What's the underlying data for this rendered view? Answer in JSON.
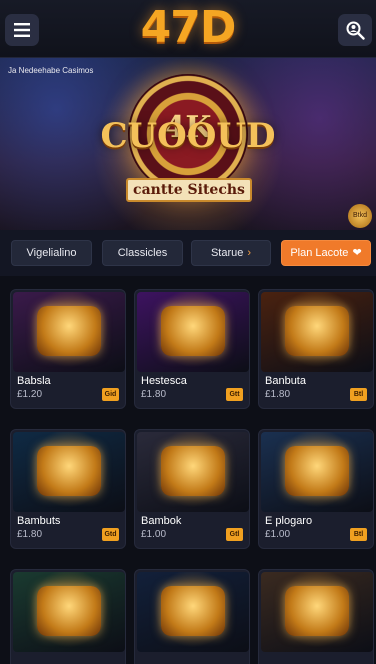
{
  "header": {
    "logo": "47D",
    "menu_icon": "hamburger-menu-icon",
    "search_icon": "search-user-icon"
  },
  "hero": {
    "caption": "Ja Nedeehabe Casimos",
    "big_number": "4K",
    "title": "CUOOUD",
    "subtitle": "cantte Sitechs",
    "coin_label": "Btkd"
  },
  "filters": [
    {
      "label": "Vigelialino",
      "arrow": ""
    },
    {
      "label": "Classicles",
      "arrow": ""
    },
    {
      "label": "Starue",
      "arrow": "›"
    },
    {
      "label": "Plan Lacote",
      "arrow": "❤"
    }
  ],
  "games": [
    {
      "name": "Babsla",
      "price": "£1.20",
      "badge": "Gid",
      "theme": "#3a1a4a"
    },
    {
      "name": "Hestesca",
      "price": "£1.80",
      "badge": "Gtt",
      "theme": "#3d1360"
    },
    {
      "name": "Banbuta",
      "price": "£1.80",
      "badge": "Btl",
      "theme": "#4a2210"
    },
    {
      "name": "Bambuts",
      "price": "£1.80",
      "badge": "Gtd",
      "theme": "#0f2a44"
    },
    {
      "name": "Bambok",
      "price": "£1.00",
      "badge": "Gtl",
      "theme": "#2a2a3a"
    },
    {
      "name": "E plogaro",
      "price": "£1.00",
      "badge": "Btl",
      "theme": "#1a3050"
    },
    {
      "name": "",
      "price": "",
      "badge": "",
      "theme": "#1a3a30"
    },
    {
      "name": "",
      "price": "",
      "badge": "",
      "theme": "#12203a"
    },
    {
      "name": "",
      "price": "",
      "badge": "",
      "theme": "#3a2a20"
    }
  ],
  "colors": {
    "accent": "#f07a2a",
    "logo": "#f5a623",
    "background": "#0d0f17"
  }
}
